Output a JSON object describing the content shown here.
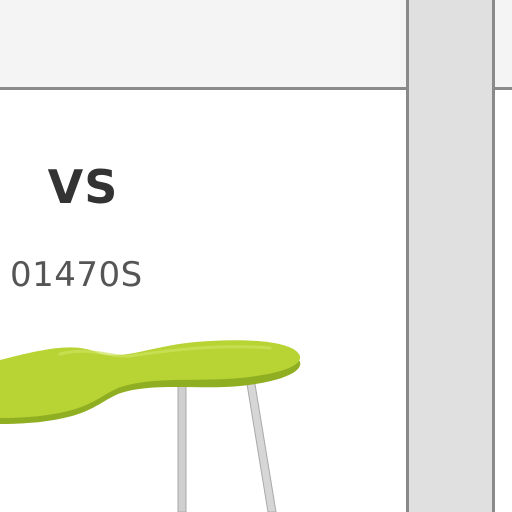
{
  "product": {
    "brand": "VS",
    "code": "01470S",
    "image_icon": "kidney-table-icon",
    "tabletop_color": "#b7d334",
    "leg_color": "#c8c8c8"
  },
  "colors": {
    "divider": "#8a8a8a",
    "gutter": "#e0e0e0",
    "band": "#f4f4f4"
  }
}
